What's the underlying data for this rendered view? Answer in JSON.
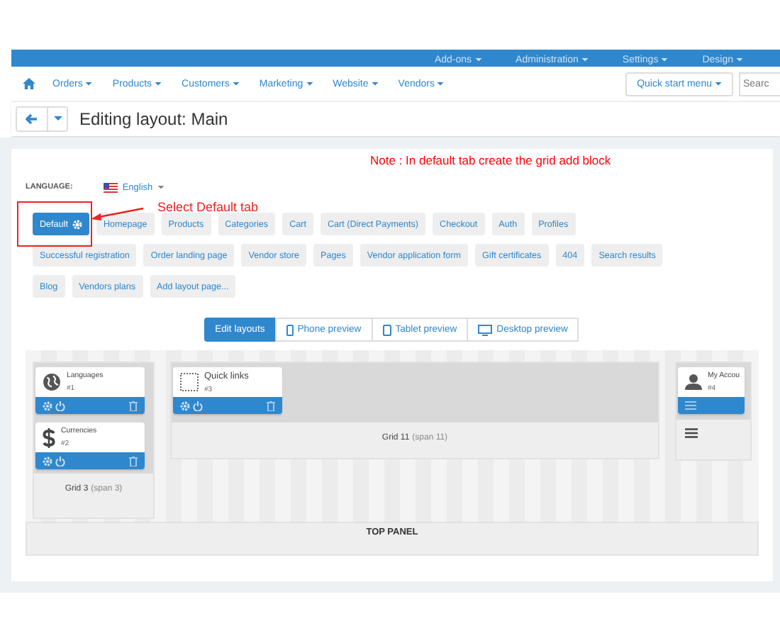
{
  "top_bar": {
    "items": [
      "Add-ons",
      "Administration",
      "Settings",
      "Design"
    ]
  },
  "nav": {
    "items": [
      "Orders",
      "Products",
      "Customers",
      "Marketing",
      "Website",
      "Vendors"
    ],
    "quick_start": "Quick start menu",
    "search": {
      "placeholder": "Searc"
    }
  },
  "page_title": "Editing layout: Main",
  "annotations": {
    "note": "Note : In default tab create the grid add block",
    "callout": "Select Default tab"
  },
  "language": {
    "label": "LANGUAGE:",
    "value": "English"
  },
  "layout_tabs": [
    {
      "label": "Default",
      "selected": true
    },
    {
      "label": "Homepage",
      "selected": false
    },
    {
      "label": "Products",
      "selected": false
    },
    {
      "label": "Categories",
      "selected": false
    },
    {
      "label": "Cart",
      "selected": false
    },
    {
      "label": "Cart (Direct Payments)",
      "selected": false
    },
    {
      "label": "Checkout",
      "selected": false
    },
    {
      "label": "Auth",
      "selected": false
    },
    {
      "label": "Profiles",
      "selected": false
    },
    {
      "label": "Successful registration",
      "selected": false
    },
    {
      "label": "Order landing page",
      "selected": false
    },
    {
      "label": "Vendor store",
      "selected": false
    },
    {
      "label": "Pages",
      "selected": false
    },
    {
      "label": "Vendor application form",
      "selected": false
    },
    {
      "label": "Gift certificates",
      "selected": false
    },
    {
      "label": "404",
      "selected": false
    },
    {
      "label": "Search results",
      "selected": false
    },
    {
      "label": "Blog",
      "selected": false
    },
    {
      "label": "Vendors plans",
      "selected": false
    },
    {
      "label": "Add layout page...",
      "selected": false
    }
  ],
  "view_modes": [
    {
      "label": "Edit layouts",
      "selected": true
    },
    {
      "label": "Phone preview",
      "selected": false
    },
    {
      "label": "Tablet preview",
      "selected": false
    },
    {
      "label": "Desktop preview",
      "selected": false
    }
  ],
  "grids": [
    {
      "name": "Grid 3",
      "span": "(span 3)",
      "blocks": [
        {
          "kind": "block",
          "title": "Languages",
          "number": "#1"
        },
        {
          "kind": "block",
          "title": "Currencies",
          "number": "#2"
        }
      ]
    },
    {
      "name": "Grid 11",
      "span": "(span 11)",
      "blocks": [
        {
          "kind": "block",
          "title": "Quick links",
          "number": "#3"
        }
      ]
    },
    {
      "kind": "cut",
      "blocks": [
        {
          "kind": "menu-block",
          "title": "My Accou",
          "number": "#4"
        }
      ]
    }
  ],
  "top_panel": "TOP PANEL"
}
